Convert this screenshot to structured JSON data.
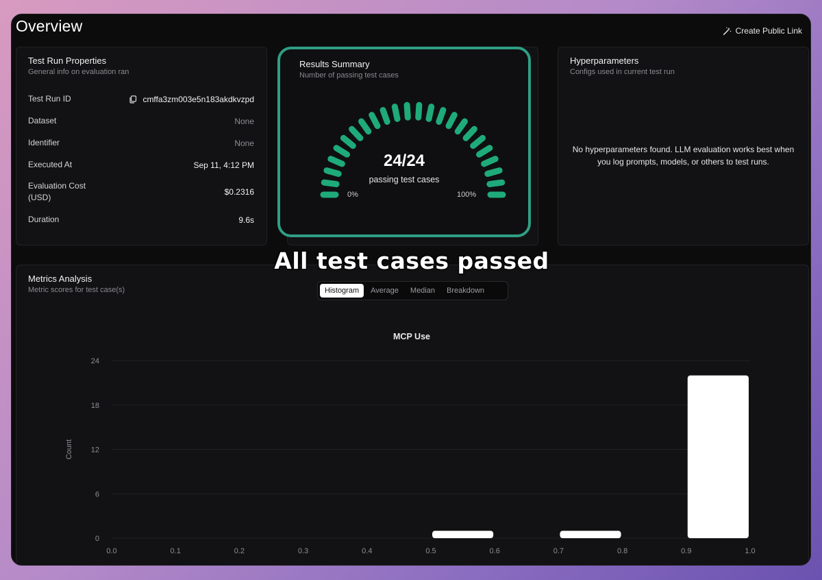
{
  "header": {
    "title": "Overview",
    "public_link_label": "Create Public Link"
  },
  "test_run_properties": {
    "title": "Test Run Properties",
    "subtitle": "General info on evaluation ran",
    "rows": [
      {
        "label": "Test Run ID",
        "value": "cmffa3zm003e5n183akdkvzpd"
      },
      {
        "label": "Dataset",
        "value": "None"
      },
      {
        "label": "Identifier",
        "value": "None"
      },
      {
        "label": "Executed At",
        "value": "Sep 11, 4:12 PM"
      },
      {
        "label": "Evaluation Cost (USD)",
        "value": "$0.2316"
      },
      {
        "label": "Duration",
        "value": "9.6s"
      }
    ]
  },
  "results_summary": {
    "title": "Results Summary",
    "subtitle": "Number of passing test cases",
    "passed": 24,
    "total": 24,
    "score_text": "24/24",
    "caption": "passing test cases",
    "min_label": "0%",
    "max_label": "100%",
    "accent_color": "#1faa7a"
  },
  "hyperparameters": {
    "title": "Hyperparameters",
    "subtitle": "Configs used in current test run",
    "empty_message": "No hyperparameters found. LLM evaluation works best when you log prompts, models, or others to test runs."
  },
  "overlay_caption": "All test cases passed",
  "metrics_analysis": {
    "title": "Metrics Analysis",
    "subtitle": "Metric scores for test case(s)",
    "tabs": [
      {
        "label": "Histogram",
        "active": true
      },
      {
        "label": "Average",
        "active": false
      },
      {
        "label": "Median",
        "active": false
      },
      {
        "label": "Breakdown",
        "active": false
      }
    ]
  },
  "chart_data": {
    "type": "bar",
    "title": "MCP Use",
    "xlabel": "",
    "ylabel": "Count",
    "xlim": [
      0.0,
      1.0
    ],
    "ylim": [
      0,
      24
    ],
    "x_ticks": [
      "0.0",
      "0.1",
      "0.2",
      "0.3",
      "0.4",
      "0.5",
      "0.6",
      "0.7",
      "0.8",
      "0.9",
      "1.0"
    ],
    "y_ticks": [
      "0",
      "6",
      "12",
      "18",
      "24"
    ],
    "bins": [
      {
        "x0": 0.5,
        "x1": 0.6,
        "count": 1
      },
      {
        "x0": 0.7,
        "x1": 0.8,
        "count": 1
      },
      {
        "x0": 0.9,
        "x1": 1.0,
        "count": 22
      }
    ],
    "bar_color": "#ffffff",
    "grid": true
  }
}
